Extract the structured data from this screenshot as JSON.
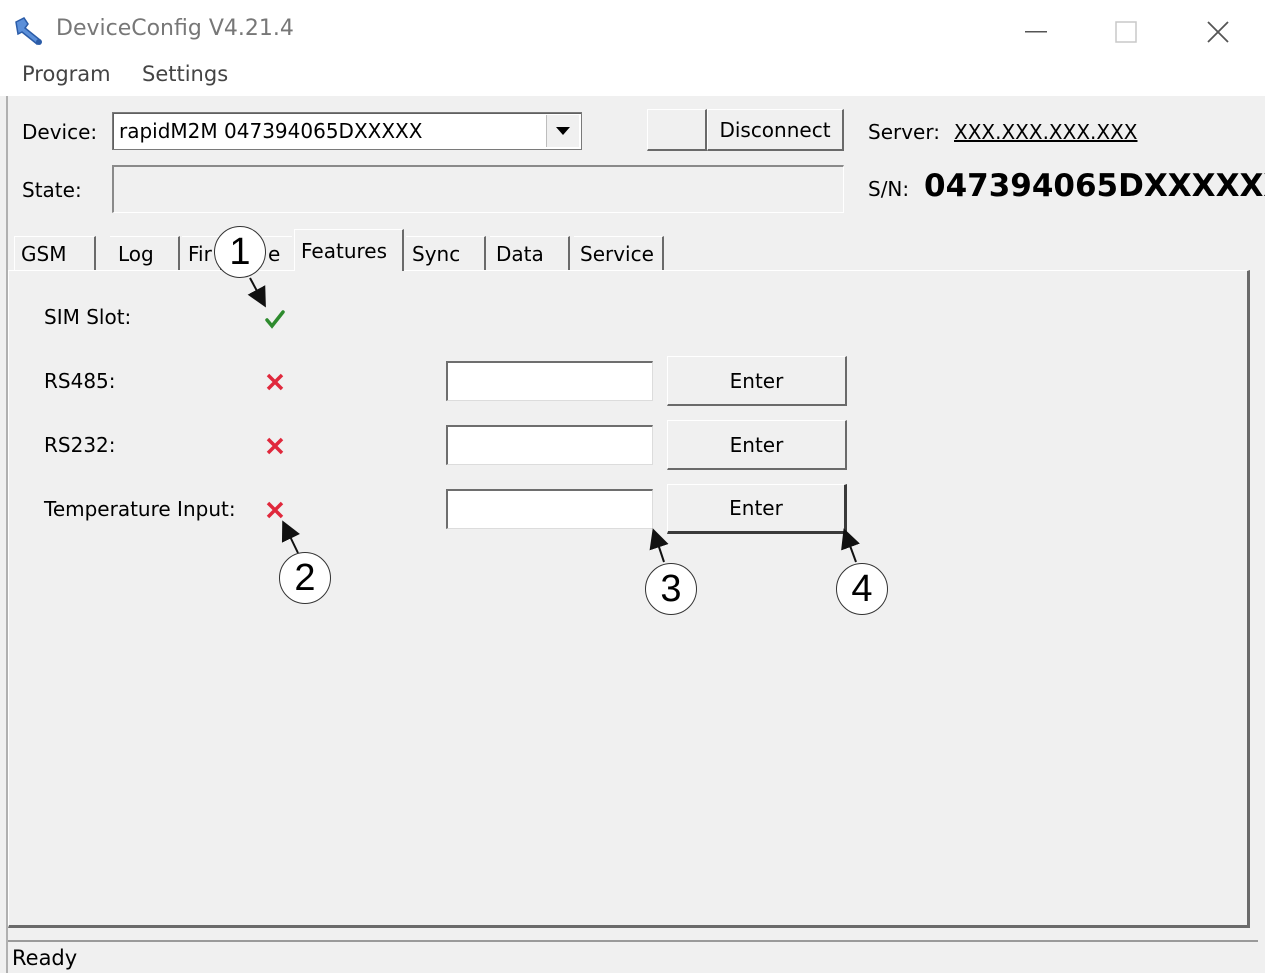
{
  "window": {
    "title": "DeviceConfig V4.21.4",
    "minimize": "—",
    "maximize": "☐",
    "close": "✕"
  },
  "menu": {
    "items": [
      "Program",
      "Settings"
    ]
  },
  "device": {
    "label": "Device:",
    "value": "rapidM2M 047394065DXXXXX",
    "disconnect_label": "Disconnect"
  },
  "state": {
    "label": "State:"
  },
  "server": {
    "label": "Server:",
    "value": "XXX.XXX.XXX.XXX"
  },
  "serial": {
    "label": "S/N:",
    "value": "047394065DXXXXXX"
  },
  "tabs": [
    "GSM",
    "Log",
    "Fir",
    "e",
    "Features",
    "Sync",
    "Data",
    "Service"
  ],
  "features": [
    {
      "label": "SIM Slot:",
      "status": "ok"
    },
    {
      "label": "RS485:",
      "status": "missing",
      "button": "Enter"
    },
    {
      "label": "RS232:",
      "status": "missing",
      "button": "Enter"
    },
    {
      "label": "Temperature Input:",
      "status": "missing",
      "button": "Enter"
    }
  ],
  "callouts": [
    "1",
    "2",
    "3",
    "4"
  ],
  "status_bar": {
    "text": "Ready"
  },
  "colors": {
    "ok": "#2e8b2e",
    "missing": "#e0283c"
  }
}
